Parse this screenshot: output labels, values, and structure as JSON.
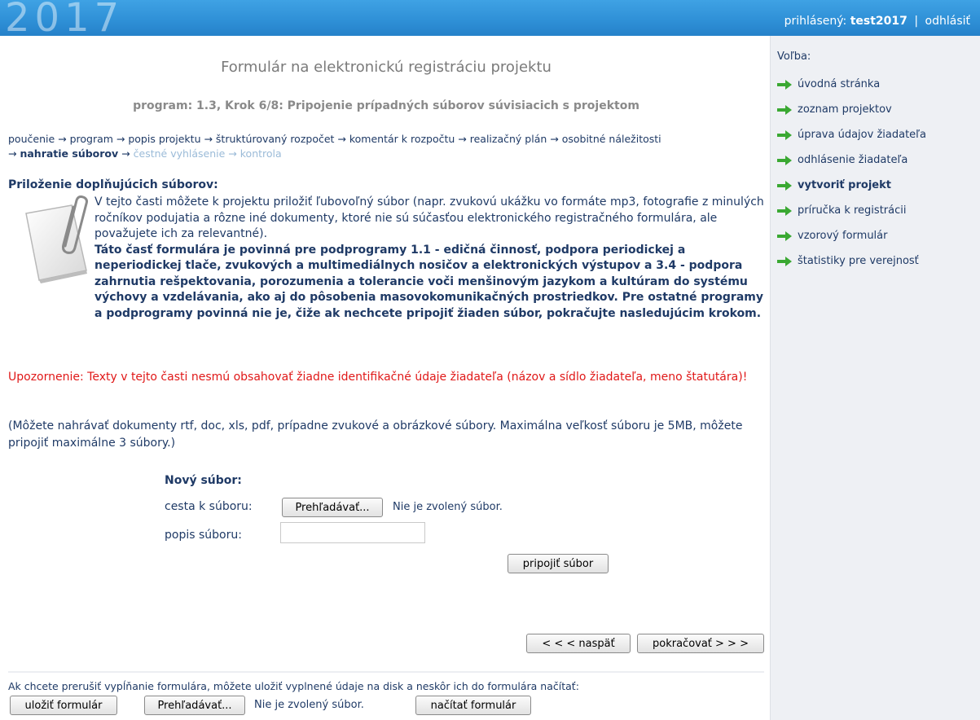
{
  "header": {
    "year": "2017",
    "logged_in_label": "prihlásený:",
    "username": "test2017",
    "separator": "|",
    "logout": "odhlásiť"
  },
  "sidebar": {
    "heading": "Voľba:",
    "items": [
      {
        "label": "úvodná stránka",
        "bold": false
      },
      {
        "label": "zoznam projektov",
        "bold": false
      },
      {
        "label": "úprava údajov žiadateľa",
        "bold": false
      },
      {
        "label": "odhlásenie žiadateľa",
        "bold": false
      },
      {
        "label": "vytvoriť projekt",
        "bold": true
      },
      {
        "label": "príručka k registrácii",
        "bold": false
      },
      {
        "label": "vzorový formulár",
        "bold": false
      },
      {
        "label": "štatistiky pre verejnosť",
        "bold": false
      }
    ],
    "arrow_color": "#3aa832"
  },
  "main": {
    "title": "Formulár na elektronickú registráciu projektu",
    "subtitle": "program: 1.3, Krok 6/8: Pripojenie prípadných súborov súvisiacich s projektom",
    "breadcrumb": {
      "done": "poučenie → program → popis projektu → štruktúrovaný rozpočet → komentár k rozpočtu → realizačný plán → osobitné náležitosti",
      "arrow": "→",
      "current": "nahratie súborov",
      "future": "čestné vyhlásenie → kontrola"
    },
    "section_title": "Priloženie doplňujúcich súborov:",
    "description": "V tejto časti môžete k projektu priložiť ľubovoľný súbor (napr. zvukovú ukážku vo formáte mp3, fotografie z minulých ročníkov podujatia a rôzne iné dokumenty, ktoré nie sú súčasťou elektronického registračného formulára, ale považujete ich za relevantné).",
    "mandatory_text": "Táto časť formulára je povinná pre podprogramy 1.1 - edičná činnosť, podpora periodickej a neperiodickej tlače, zvukových a multimediálnych nosičov a elektronických výstupov a 3.4 - podpora zahrnutia rešpektovania, porozumenia a tolerancie voči menšinovým jazykom a kultúram do systému výchovy a vzdelávania, ako aj do pôsobenia masovokomunikačných prostriedkov. Pre ostatné programy a podprogramy povinná nie je, čiže ak nechcete pripojiť žiaden súbor, pokračujte nasledujúcim krokom.",
    "warning": "Upozornenie: Texty v tejto časti nesmú obsahovať žiadne identifikačné údaje žiadateľa (názov a sídlo žiadateľa, meno štatutára)!",
    "note": "(Môžete nahrávať dokumenty rtf, doc, xls, pdf, prípadne zvukové a obrázkové súbory. Maximálna veľkosť súboru je 5MB, môžete pripojiť maximálne 3 súbory.)",
    "warning_color": "#e01818"
  },
  "new_file": {
    "title": "Nový súbor:",
    "path_label": "cesta k súboru:",
    "browse_button": "Prehľadávať...",
    "no_file": "Nie je zvolený súbor.",
    "desc_label": "popis súboru:",
    "desc_value": "",
    "attach_button": "pripojiť súbor"
  },
  "navigation": {
    "back_button": "< < <  naspäť",
    "next_button": "pokračovať  > > >"
  },
  "save_load": {
    "hint": "Ak chcete prerušiť vypĺňanie formulára, môžete uložiť vyplnené údaje na disk a neskôr ich do formulára načítať:",
    "save_button": "uložiť formulár",
    "browse_button": "Prehľadávať...",
    "no_file": "Nie je zvolený súbor.",
    "load_button": "načítať formulár"
  }
}
